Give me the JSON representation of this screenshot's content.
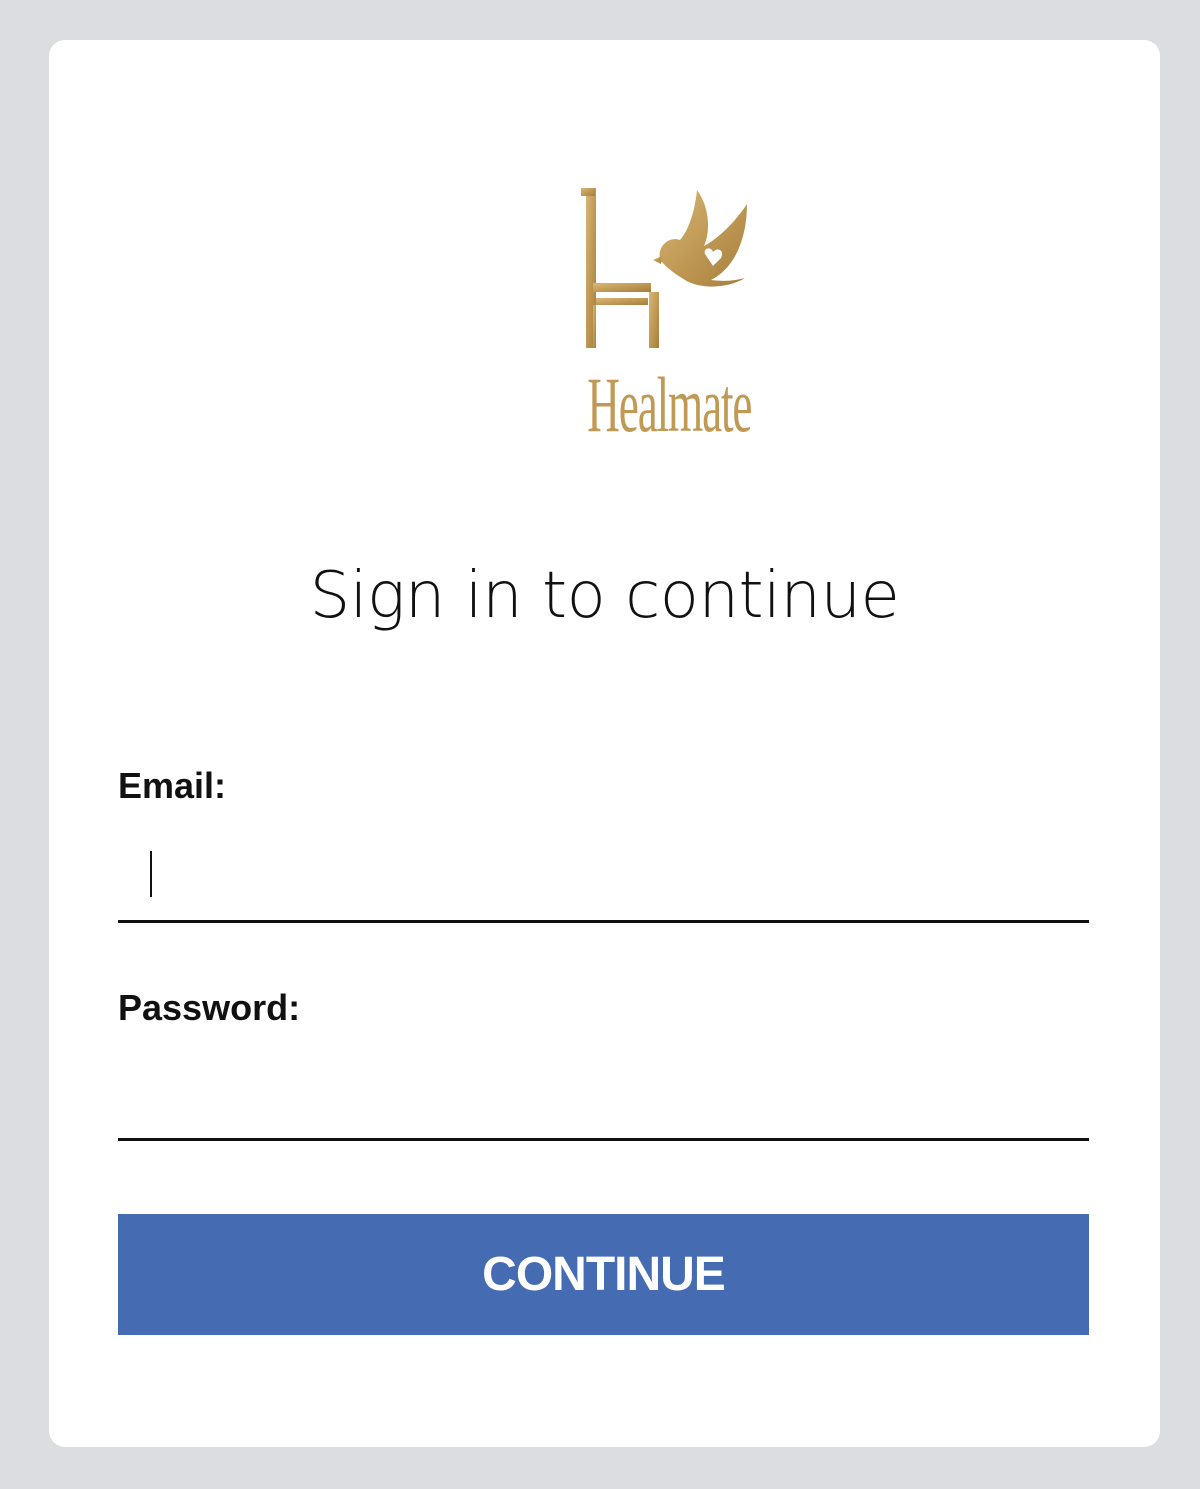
{
  "brand": {
    "name": "Healmate",
    "logo_icon": "healmate-chair-bird-logo",
    "logo_color": "#c09a55"
  },
  "heading": "Sign in to continue",
  "form": {
    "email_label": "Email:",
    "email_value": "",
    "password_label": "Password:",
    "password_value": "",
    "continue_label": "CONTINUE"
  },
  "colors": {
    "page_background": "#dcdde1",
    "card_background": "#ffffff",
    "button_background": "#456bb2",
    "button_text": "#ffffff",
    "text": "#111111"
  }
}
